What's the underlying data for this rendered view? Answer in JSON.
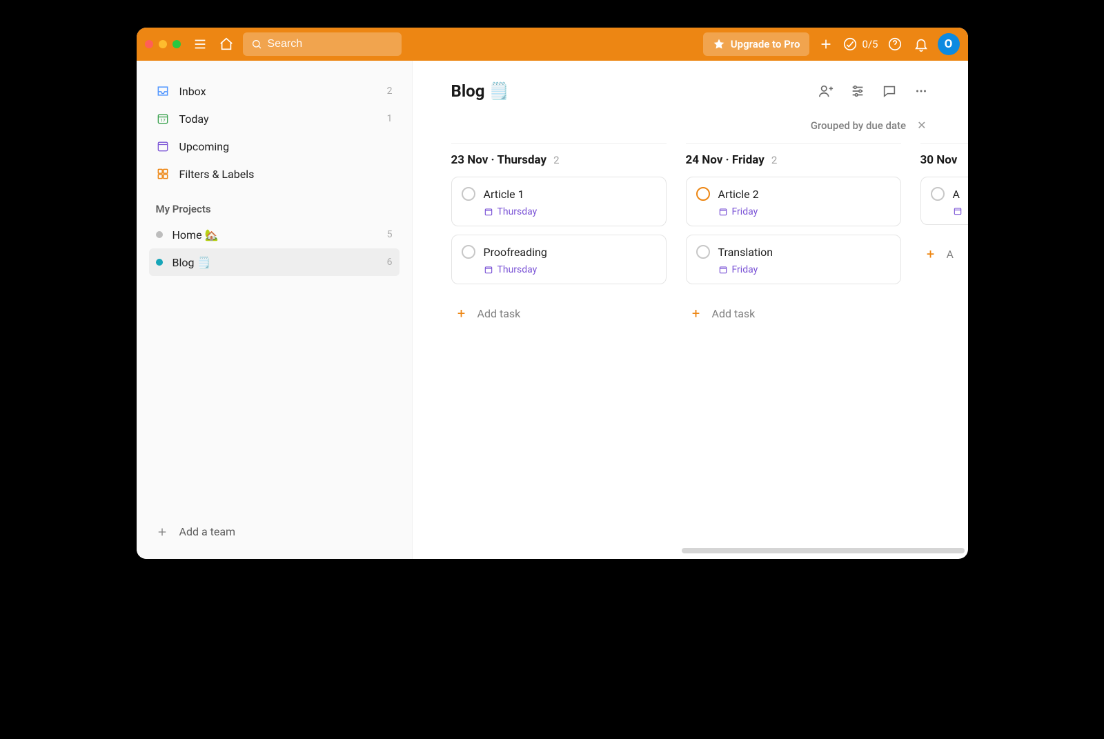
{
  "header": {
    "search_placeholder": "Search",
    "upgrade_label": "Upgrade to Pro",
    "productivity_count": "0/5",
    "avatar_initial": "O"
  },
  "sidebar": {
    "nav": [
      {
        "label": "Inbox",
        "count": "2"
      },
      {
        "label": "Today",
        "count": "1"
      },
      {
        "label": "Upcoming",
        "count": ""
      },
      {
        "label": "Filters & Labels",
        "count": ""
      }
    ],
    "projects_title": "My Projects",
    "projects": [
      {
        "label": "Home 🏡",
        "count": "5"
      },
      {
        "label": "Blog 🗒️",
        "count": "6"
      }
    ],
    "add_team": "Add a team"
  },
  "main": {
    "title": "Blog 🗒️",
    "grouped_by": "Grouped by due date"
  },
  "columns": [
    {
      "date": "23 Nov · Thursday",
      "count": "2",
      "tasks": [
        {
          "title": "Article 1",
          "due": "Thursday",
          "priority": ""
        },
        {
          "title": "Proofreading",
          "due": "Thursday",
          "priority": ""
        }
      ],
      "add": "Add task"
    },
    {
      "date": "24 Nov · Friday",
      "count": "2",
      "tasks": [
        {
          "title": "Article 2",
          "due": "Friday",
          "priority": "p2"
        },
        {
          "title": "Translation",
          "due": "Friday",
          "priority": ""
        }
      ],
      "add": "Add task"
    },
    {
      "date": "30 Nov",
      "count": "",
      "tasks": [
        {
          "title": "A",
          "due": "",
          "priority": ""
        }
      ],
      "add": "A"
    }
  ]
}
